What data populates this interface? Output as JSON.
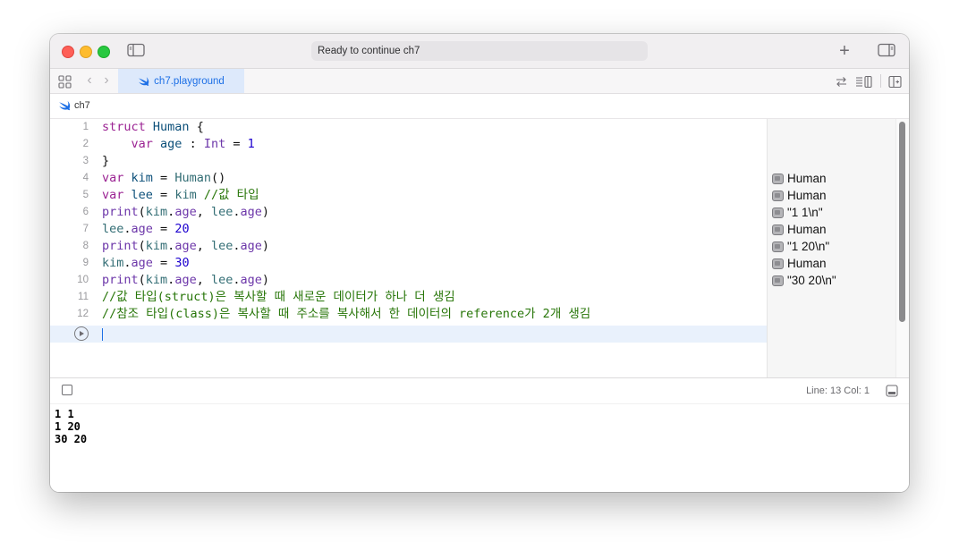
{
  "window": {
    "status": "Ready to continue ch7",
    "plus_label": "+"
  },
  "tabbar": {
    "back": "‹",
    "forward": "›",
    "active_tab": "ch7.playground"
  },
  "jumpbar": {
    "crumb": "ch7"
  },
  "editor": {
    "lines": [
      {
        "n": "1"
      },
      {
        "n": "2"
      },
      {
        "n": "3"
      },
      {
        "n": "4"
      },
      {
        "n": "5"
      },
      {
        "n": "6"
      },
      {
        "n": "7"
      },
      {
        "n": "8"
      },
      {
        "n": "9"
      },
      {
        "n": "10"
      },
      {
        "n": "11"
      },
      {
        "n": "12"
      }
    ],
    "comment_line5": "//값 타입",
    "comment_line11": "//값 타입(struct)은 복사할 때 새로운 데이터가 하나 더 생김",
    "comment_line12": "//참조 타입(class)은 복사할 때 주소를 복사해서 한 데이터의 reference가 2개 생김"
  },
  "results": [
    {
      "line": 4,
      "text": "Human"
    },
    {
      "line": 5,
      "text": "Human"
    },
    {
      "line": 6,
      "text": "\"1 1\\n\""
    },
    {
      "line": 7,
      "text": "Human"
    },
    {
      "line": 8,
      "text": "\"1 20\\n\""
    },
    {
      "line": 9,
      "text": "Human"
    },
    {
      "line": 10,
      "text": "\"30 20\\n\""
    }
  ],
  "debugbar": {
    "position": "Line: 13  Col: 1"
  },
  "console": {
    "lines": [
      "1 1",
      "1 20",
      "30 20"
    ]
  },
  "colors": {
    "keyword": "#9b2393",
    "type": "#0b4f79",
    "identifier": "#326d74",
    "number": "#1c00cf",
    "member": "#6c36a9",
    "comment": "#267507",
    "accent": "#1c6fe6"
  }
}
